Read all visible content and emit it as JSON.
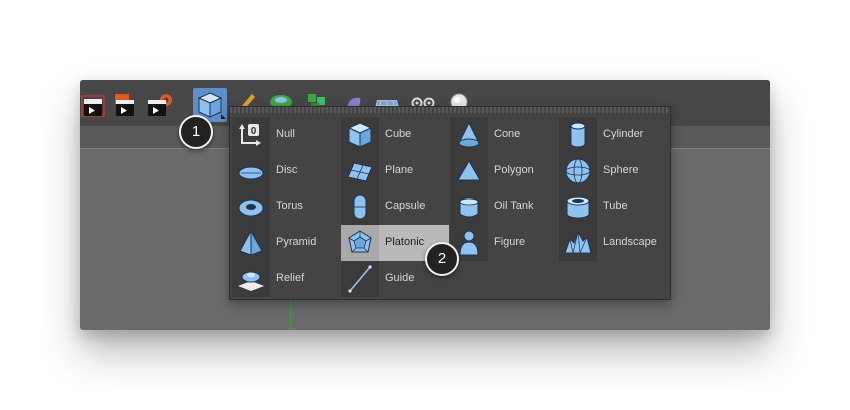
{
  "menu": {
    "columns": [
      [
        {
          "label": "Null",
          "icon": "null-icon"
        },
        {
          "label": "Disc",
          "icon": "disc-icon"
        },
        {
          "label": "Torus",
          "icon": "torus-icon"
        },
        {
          "label": "Pyramid",
          "icon": "pyramid-icon"
        },
        {
          "label": "Relief",
          "icon": "relief-icon"
        }
      ],
      [
        {
          "label": "Cube",
          "icon": "cube-icon"
        },
        {
          "label": "Plane",
          "icon": "plane-icon"
        },
        {
          "label": "Capsule",
          "icon": "capsule-icon"
        },
        {
          "label": "Platonic",
          "icon": "platonic-icon",
          "highlighted": true
        },
        {
          "label": "Guide",
          "icon": "guide-icon"
        }
      ],
      [
        {
          "label": "Cone",
          "icon": "cone-icon"
        },
        {
          "label": "Polygon",
          "icon": "polygon-icon"
        },
        {
          "label": "Oil Tank",
          "icon": "oil-tank-icon"
        },
        {
          "label": "Figure",
          "icon": "figure-icon"
        }
      ],
      [
        {
          "label": "Cylinder",
          "icon": "cylinder-icon"
        },
        {
          "label": "Sphere",
          "icon": "sphere-icon"
        },
        {
          "label": "Tube",
          "icon": "tube-icon"
        },
        {
          "label": "Landscape",
          "icon": "landscape-icon"
        }
      ]
    ]
  },
  "badges": [
    "1",
    "2"
  ],
  "toolbar": {
    "icons": [
      "render-view-icon",
      "render-picture-viewer-icon",
      "render-settings-icon",
      "cube-primitives-icon",
      "pen-spline-icon",
      "subdivision-icon",
      "mograph-cloner-icon",
      "deformer-icon",
      "environment-floor-icon",
      "camera-icon",
      "light-icon"
    ]
  },
  "colors": {
    "accent": "#5f8fc8",
    "icon_blue": "#8fc2ee",
    "highlight": "#b9b9b9",
    "menu_bg": "#444444"
  }
}
